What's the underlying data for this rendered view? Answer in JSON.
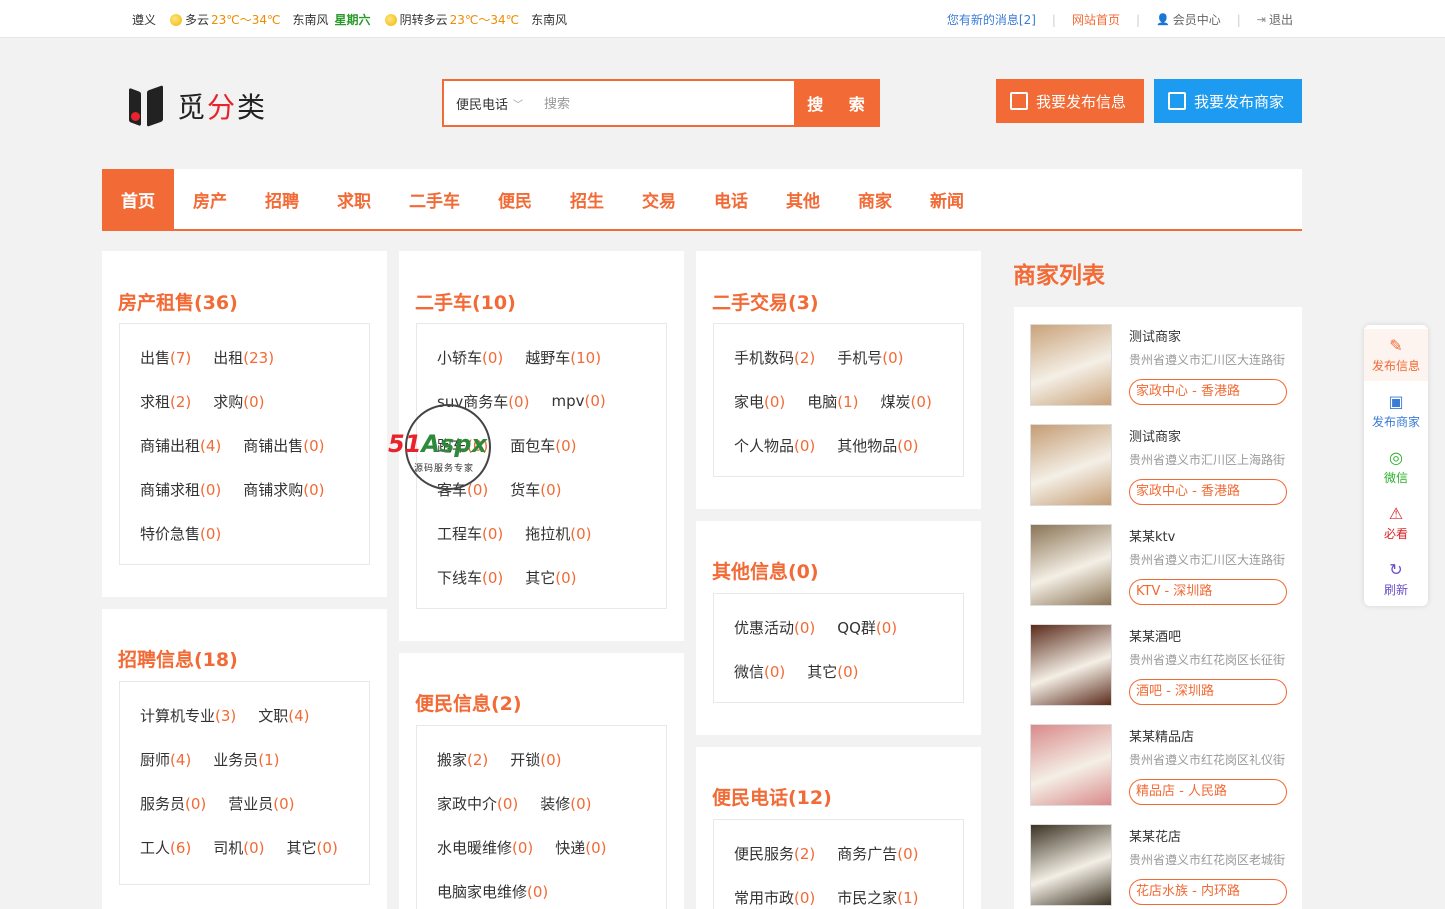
{
  "topbar": {
    "city": "遵义",
    "w1": "多云",
    "t1": "23℃～34℃",
    "wind1": "东南风",
    "weekday": "星期六",
    "w2": "阴转多云",
    "t2": "23℃～34℃",
    "wind2": "东南风",
    "msg": "您有新的消息[2]",
    "home": "网站首页",
    "member": "会员中心",
    "logout": "退出"
  },
  "logo": {
    "text_a": "觅",
    "text_b": "分",
    "text_c": "类"
  },
  "search": {
    "category": "便民电话",
    "placeholder": "搜索",
    "button": "搜 索"
  },
  "buttons": {
    "post_info": "我要发布信息",
    "post_shop": "我要发布商家"
  },
  "nav": [
    "首页",
    "房产",
    "招聘",
    "求职",
    "二手车",
    "便民",
    "招生",
    "交易",
    "电话",
    "其他",
    "商家",
    "新闻"
  ],
  "cards": {
    "house": {
      "title": "房产租售(36)",
      "rows": [
        [
          [
            "出售",
            "(7)"
          ],
          [
            "出租",
            "(23)"
          ]
        ],
        [
          [
            "求租",
            "(2)"
          ],
          [
            "求购",
            "(0)"
          ]
        ],
        [
          [
            "商铺出租",
            "(4)"
          ],
          [
            "商铺出售",
            "(0)"
          ]
        ],
        [
          [
            "商铺求租",
            "(0)"
          ],
          [
            "商铺求购",
            "(0)"
          ]
        ],
        [
          [
            "特价急售",
            "(0)"
          ]
        ]
      ]
    },
    "car": {
      "title": "二手车(10)",
      "rows": [
        [
          [
            "小轿车",
            "(0)"
          ],
          [
            "越野车",
            "(10)"
          ]
        ],
        [
          [
            "suv商务车",
            "(0)"
          ],
          [
            "mpv",
            "(0)"
          ]
        ],
        [
          [
            "跑车",
            "(0)"
          ],
          [
            "面包车",
            "(0)"
          ]
        ],
        [
          [
            "客车",
            "(0)"
          ],
          [
            "货车",
            "(0)"
          ]
        ],
        [
          [
            "工程车",
            "(0)"
          ],
          [
            "拖拉机",
            "(0)"
          ]
        ],
        [
          [
            "下线车",
            "(0)"
          ],
          [
            "其它",
            "(0)"
          ]
        ]
      ]
    },
    "trade": {
      "title": "二手交易(3)",
      "rows": [
        [
          [
            "手机数码",
            "(2)"
          ],
          [
            "手机号",
            "(0)"
          ]
        ],
        [
          [
            "家电",
            "(0)"
          ],
          [
            "电脑",
            "(1)"
          ],
          [
            "煤炭",
            "(0)"
          ]
        ],
        [
          [
            "个人物品",
            "(0)"
          ],
          [
            "其他物品",
            "(0)"
          ]
        ]
      ]
    },
    "other": {
      "title": "其他信息(0)",
      "rows": [
        [
          [
            "优惠活动",
            "(0)"
          ],
          [
            "QQ群",
            "(0)"
          ]
        ],
        [
          [
            "微信",
            "(0)"
          ],
          [
            "其它",
            "(0)"
          ]
        ]
      ]
    },
    "job": {
      "title": "招聘信息(18)",
      "rows": [
        [
          [
            "计算机专业",
            "(3)"
          ],
          [
            "文职",
            "(4)"
          ]
        ],
        [
          [
            "厨师",
            "(4)"
          ],
          [
            "业务员",
            "(1)"
          ]
        ],
        [
          [
            "服务员",
            "(0)"
          ],
          [
            "营业员",
            "(0)"
          ]
        ],
        [
          [
            "工人",
            "(6)"
          ],
          [
            "司机",
            "(0)"
          ],
          [
            "其它",
            "(0)"
          ]
        ]
      ]
    },
    "service": {
      "title": "便民信息(2)",
      "rows": [
        [
          [
            "搬家",
            "(2)"
          ],
          [
            "开锁",
            "(0)"
          ]
        ],
        [
          [
            "家政中介",
            "(0)"
          ],
          [
            "装修",
            "(0)"
          ]
        ],
        [
          [
            "水电暖维修",
            "(0)"
          ],
          [
            "快递",
            "(0)"
          ]
        ],
        [
          [
            "电脑家电维修",
            "(0)"
          ]
        ]
      ]
    },
    "phone": {
      "title": "便民电话(12)",
      "rows": [
        [
          [
            "便民服务",
            "(2)"
          ],
          [
            "商务广告",
            "(0)"
          ]
        ],
        [
          [
            "常用市政",
            "(0)"
          ],
          [
            "市民之家",
            "(1)"
          ]
        ]
      ]
    }
  },
  "shops": {
    "title": "商家列表",
    "items": [
      {
        "name": "测试商家",
        "addr": "贵州省遵义市汇川区大连路街",
        "badge": "家政中心 - 香港路",
        "color": "#c9a27a"
      },
      {
        "name": "测试商家",
        "addr": "贵州省遵义市汇川区上海路街",
        "badge": "家政中心 - 香港路",
        "color": "#c49c74"
      },
      {
        "name": "某某ktv",
        "addr": "贵州省遵义市汇川区大连路街",
        "badge": "KTV - 深圳路",
        "color": "#8a7455"
      },
      {
        "name": "某某酒吧",
        "addr": "贵州省遵义市红花岗区长征街",
        "badge": "酒吧 - 深圳路",
        "color": "#5a2a1a"
      },
      {
        "name": "某某精品店",
        "addr": "贵州省遵义市红花岗区礼仪街",
        "badge": "精品店 - 人民路",
        "color": "#d98a8a"
      },
      {
        "name": "某某花店",
        "addr": "贵州省遵义市红花岗区老城街",
        "badge": "花店水族 - 内环路",
        "color": "#3a3222"
      }
    ]
  },
  "sidebar": {
    "post_info": "发布信息",
    "post_shop": "发布商家",
    "wechat": "微信",
    "must": "必看",
    "refresh": "刷新"
  },
  "watermark": {
    "main_a": "51",
    "main_b": "Aspx",
    "sub": "源码服务专家"
  }
}
